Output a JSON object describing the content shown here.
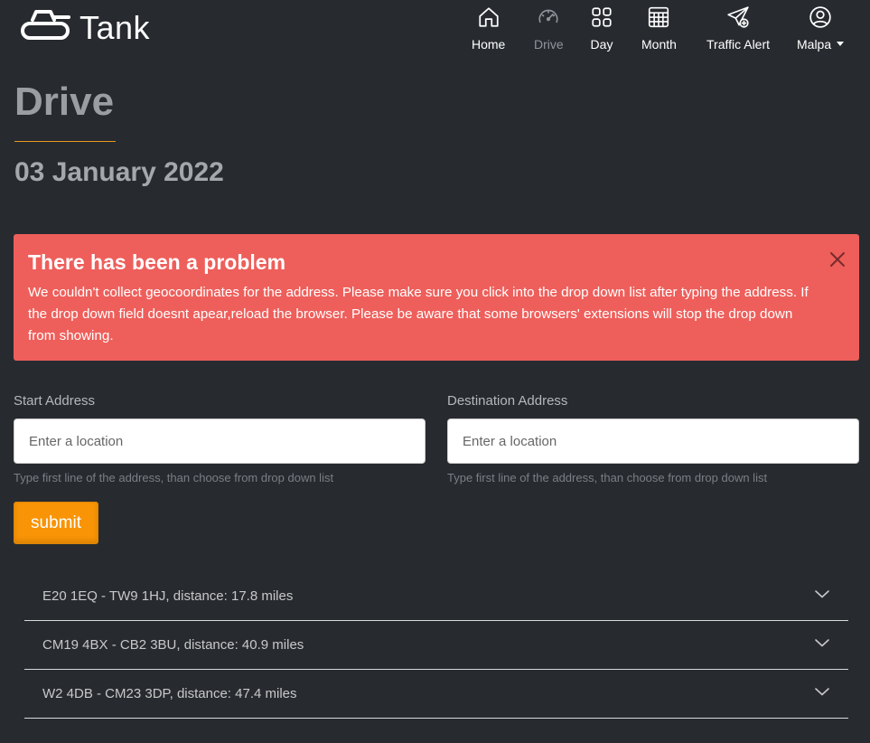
{
  "brand": {
    "name": "Tank",
    "icon": "tank-icon"
  },
  "nav": [
    {
      "label": "Home",
      "icon": "home-icon",
      "active": false
    },
    {
      "label": "Drive",
      "icon": "speedometer-icon",
      "active": true
    },
    {
      "label": "Day",
      "icon": "grid-icon",
      "active": false
    },
    {
      "label": "Month",
      "icon": "calendar-icon",
      "active": false
    },
    {
      "label": "Traffic Alert",
      "icon": "send-plus-icon",
      "active": false
    },
    {
      "label": "Malpa",
      "icon": "user-circle-icon",
      "active": false
    }
  ],
  "page": {
    "title": "Drive",
    "date": "03 January 2022"
  },
  "alert": {
    "title": "There has been a problem",
    "message": "We couldn't collect geocoordinates for the address. Please make sure you click into the drop down list after typing the address. If the drop down field doesnt apear,reload the browser. Please be aware that some browsers' extensions will stop the drop down from showing.",
    "color": "#ee5f5b"
  },
  "form": {
    "start": {
      "label": "Start Address",
      "placeholder": "Enter a location",
      "help": "Type first line of the address, than choose from drop down list"
    },
    "destination": {
      "label": "Destination Address",
      "placeholder": "Enter a location",
      "help": "Type first line of the address, than choose from drop down list"
    },
    "submit_label": "submit"
  },
  "routes": [
    "E20 1EQ - TW9 1HJ, distance: 17.8 miles",
    "CM19 4BX - CB2 3BU, distance: 40.9 miles",
    "W2 4DB - CM23 3DP, distance: 47.4 miles"
  ],
  "colors": {
    "background": "#272b30",
    "accent": "#f89406",
    "underline": "#e8961e"
  }
}
